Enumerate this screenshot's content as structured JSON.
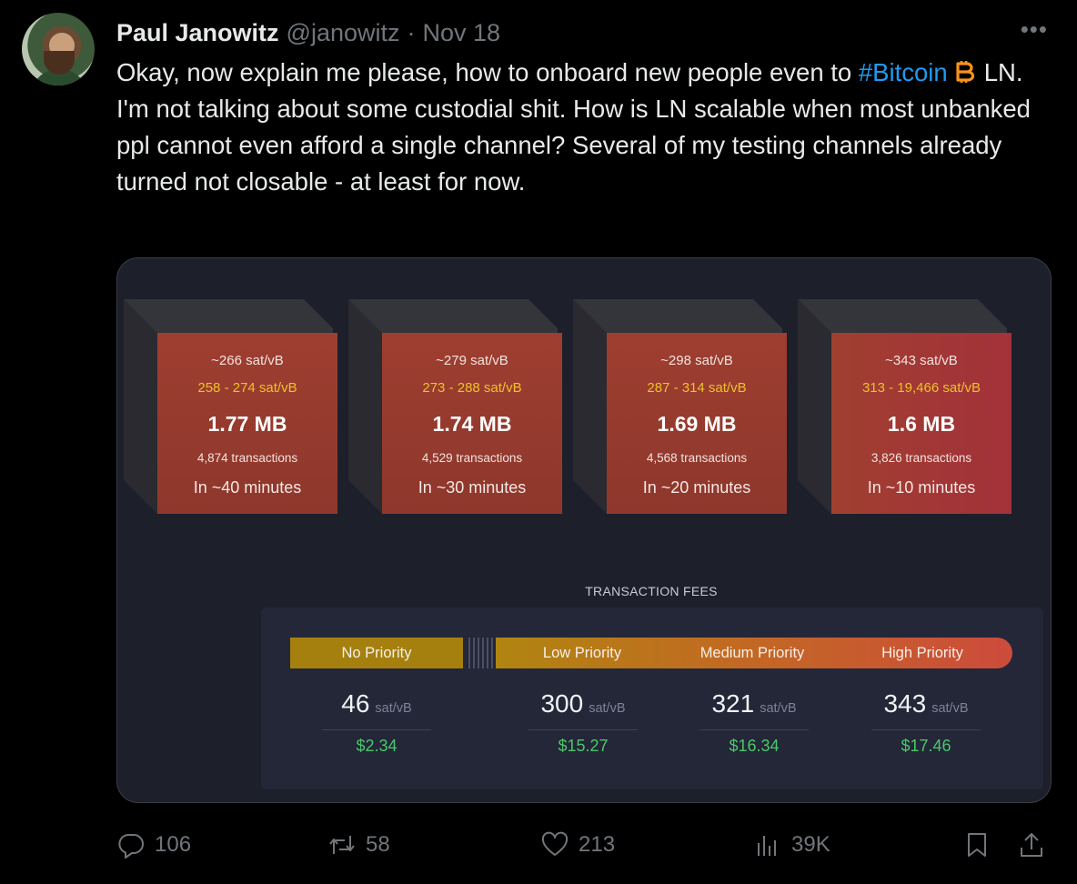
{
  "tweet": {
    "author_name": "Paul Janowitz",
    "handle": "@janowitz",
    "separator": "·",
    "date": "Nov 18",
    "more_label": "•••",
    "text_part1": "Okay, now explain me please, how to onboard new people even to",
    "hashtag": "#Bitcoin",
    "emoji": "bitcoin-emoji",
    "text_part2": "LN. I'm not talking about some custodial shit. How is LN scalable when most unbanked ppl cannot even afford a single channel? Several of my testing channels already turned not closable - at least for now."
  },
  "mempool": {
    "blocks": [
      {
        "fee": "~266 sat/vB",
        "range": "258 - 274 sat/vB",
        "size": "1.77 MB",
        "tx": "4,874 transactions",
        "time": "In ~40 minutes"
      },
      {
        "fee": "~279 sat/vB",
        "range": "273 - 288 sat/vB",
        "size": "1.74 MB",
        "tx": "4,529 transactions",
        "time": "In ~30 minutes"
      },
      {
        "fee": "~298 sat/vB",
        "range": "287 - 314 sat/vB",
        "size": "1.69 MB",
        "tx": "4,568 transactions",
        "time": "In ~20 minutes"
      },
      {
        "fee": "~343 sat/vB",
        "range": "313 - 19,466 sat/vB",
        "size": "1.6 MB",
        "tx": "3,826 transactions",
        "time": "In ~10 minutes"
      }
    ],
    "fees_title": "TRANSACTION FEES",
    "priorities": [
      {
        "label": "No Priority",
        "value": "46",
        "unit": "sat/vB",
        "usd": "$2.34"
      },
      {
        "label": "Low Priority",
        "value": "300",
        "unit": "sat/vB",
        "usd": "$15.27"
      },
      {
        "label": "Medium Priority",
        "value": "321",
        "unit": "sat/vB",
        "usd": "$16.34"
      },
      {
        "label": "High Priority",
        "value": "343",
        "unit": "sat/vB",
        "usd": "$17.46"
      }
    ]
  },
  "actions": {
    "replies": "106",
    "reposts": "58",
    "likes": "213",
    "views": "39K"
  },
  "colors": {
    "link": "#1d9bf0",
    "block_face": "#9e3e30",
    "range_text": "#eec128",
    "usd_text": "#4cc76a"
  }
}
